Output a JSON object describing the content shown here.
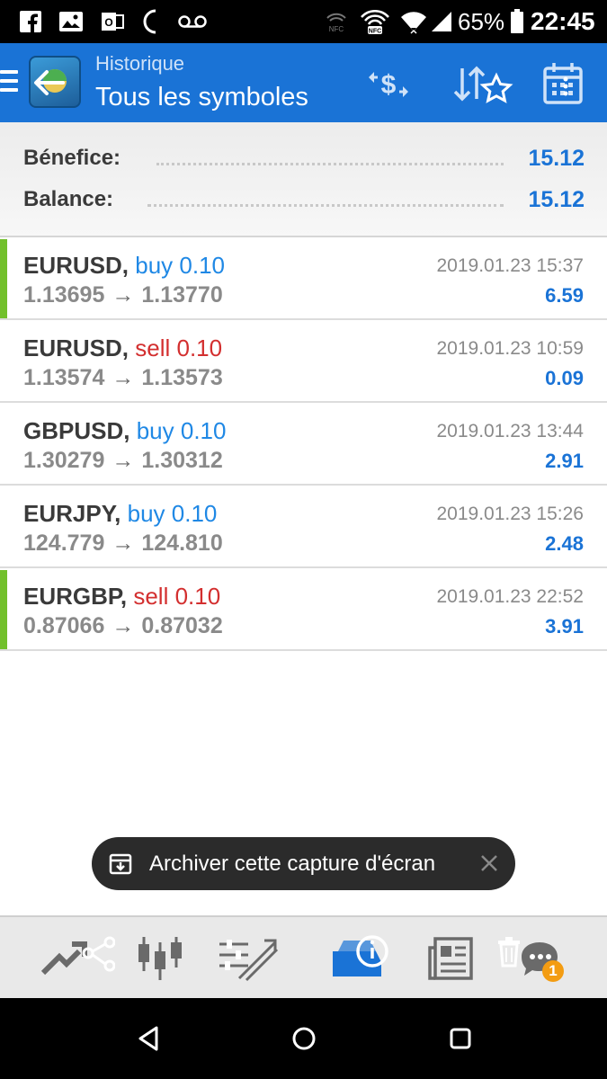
{
  "status_bar": {
    "icons": [
      "facebook-icon",
      "gallery-icon",
      "office-icon",
      "moon-icon",
      "voicemail-icon",
      "nfc-icon",
      "nfc-signal-icon",
      "wifi-icon",
      "cell-signal-icon",
      "battery-icon"
    ],
    "battery": "65%",
    "time": "22:45"
  },
  "header": {
    "subtitle": "Historique",
    "title": "Tous les symboles",
    "accent_color": "#1a73d6"
  },
  "summary": {
    "benefit_label": "Bénefice:",
    "benefit_value": "15.12",
    "balance_label": "Balance:",
    "balance_value": "15.12"
  },
  "trades": [
    {
      "symbol": "EURUSD,",
      "side": "buy",
      "volume": "0.10",
      "open": "1.13695",
      "close": "1.13770",
      "date": "2019.01.23 15:37",
      "profit": "6.59",
      "marked": true
    },
    {
      "symbol": "EURUSD,",
      "side": "sell",
      "volume": "0.10",
      "open": "1.13574",
      "close": "1.13573",
      "date": "2019.01.23 10:59",
      "profit": "0.09",
      "marked": false
    },
    {
      "symbol": "GBPUSD,",
      "side": "buy",
      "volume": "0.10",
      "open": "1.30279",
      "close": "1.30312",
      "date": "2019.01.23 13:44",
      "profit": "2.91",
      "marked": false
    },
    {
      "symbol": "EURJPY,",
      "side": "buy",
      "volume": "0.10",
      "open": "124.779",
      "close": "124.810",
      "date": "2019.01.23 15:26",
      "profit": "2.48",
      "marked": false
    },
    {
      "symbol": "EURGBP,",
      "side": "sell",
      "volume": "0.10",
      "open": "0.87066",
      "close": "0.87032",
      "date": "2019.01.23 22:52",
      "profit": "3.91",
      "marked": true
    }
  ],
  "arrow_glyph": "→",
  "toast": {
    "text": "Archiver cette capture d'écran"
  },
  "toolbar": {
    "chat_badge": "1"
  }
}
